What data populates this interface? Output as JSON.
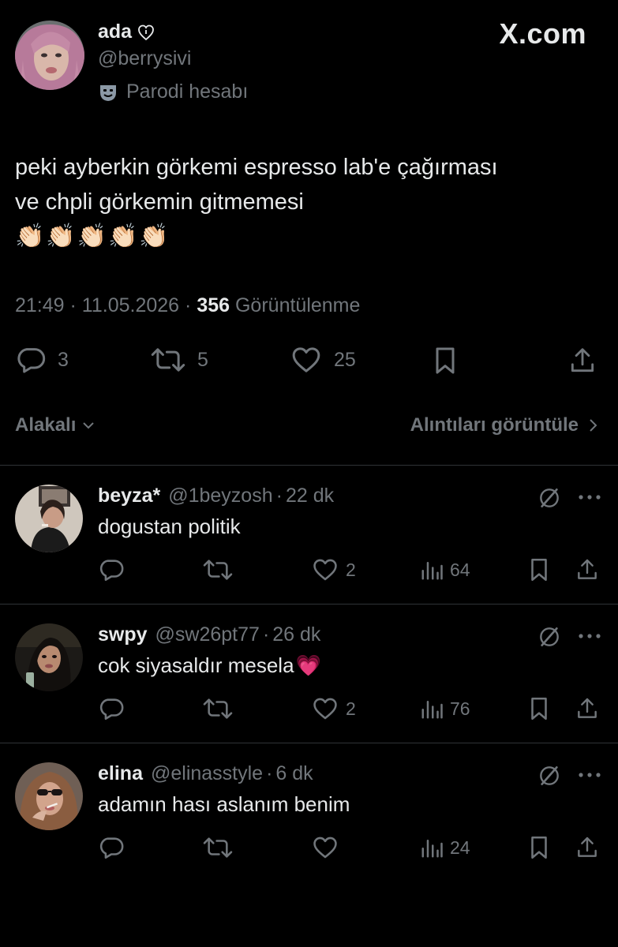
{
  "site": {
    "brand": "X.com"
  },
  "tweet": {
    "author_name": "ada",
    "author_handle": "@berrysivi",
    "parody_label": "Parodi hesabı",
    "text_line1": "peki ayberkin görkemi espresso lab'e çağırması",
    "text_line2": "ve chpli görkemin gitmemesi",
    "emoji": "👏🏻👏🏻👏🏻👏🏻👏🏻",
    "time": "21:49",
    "date": "11.05.2026",
    "views_count": "356",
    "views_label": "Görüntülenme",
    "replies": "3",
    "reposts": "5",
    "likes": "25"
  },
  "replies_bar": {
    "sort_label": "Alakalı",
    "quotes_label": "Alıntıları görüntüle"
  },
  "replies": [
    {
      "name": "beyza*",
      "handle": "@1beyzosh",
      "time": "22 dk",
      "text": "dogustan politik",
      "emoji": "",
      "likes": "2",
      "views": "64"
    },
    {
      "name": "swpy",
      "handle": "@sw26pt77",
      "time": "26 dk",
      "text": "cok siyasaldır mesela",
      "emoji": "💗",
      "likes": "2",
      "views": "76"
    },
    {
      "name": "elina",
      "handle": "@elinasstyle",
      "time": "6 dk",
      "text": "adamın hası aslanım benim",
      "emoji": "",
      "likes": "",
      "views": "24"
    }
  ],
  "colors": {
    "background": "#000000",
    "text": "#e7e9ea",
    "muted": "#71767b",
    "divider": "#2f3336",
    "heart_emoji": "#ff5fc8"
  },
  "icons": [
    "reply-icon",
    "repost-icon",
    "like-icon",
    "bookmark-icon",
    "share-icon",
    "views-icon",
    "grok-icon",
    "more-icon",
    "chevron-down-icon",
    "chevron-right-icon",
    "parody-mask-icon",
    "heart-outline-icon"
  ]
}
